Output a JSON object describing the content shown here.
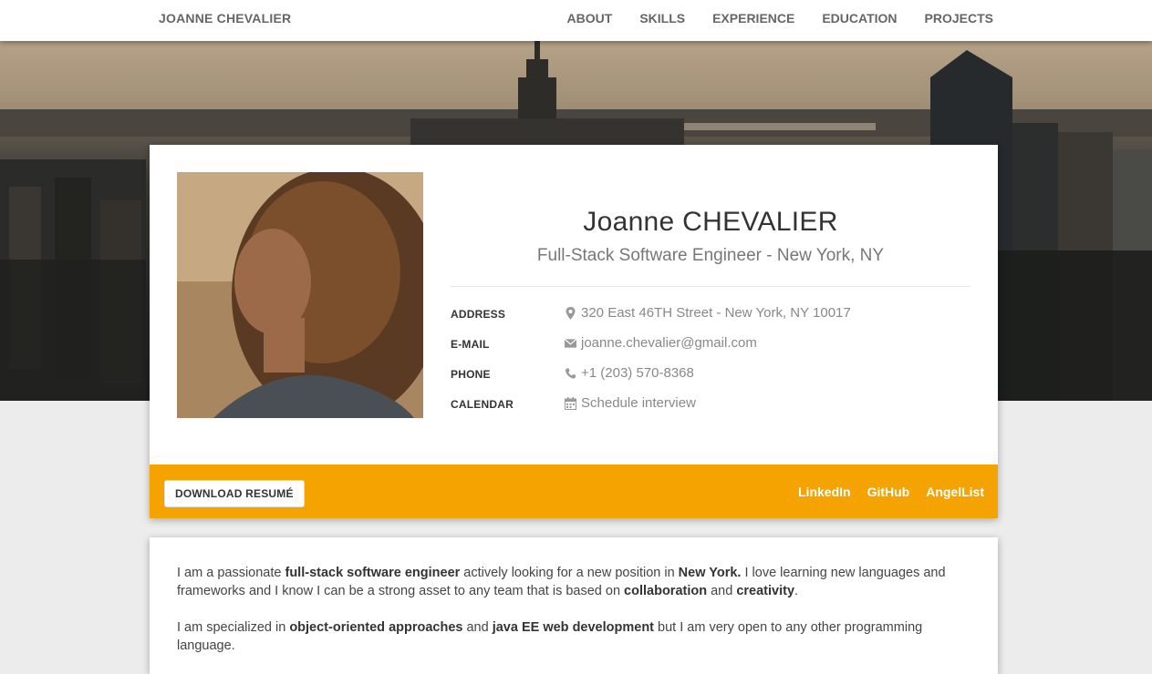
{
  "nav": {
    "brand": "JOANNE CHEVALIER",
    "links": [
      "ABOUT",
      "SKILLS",
      "EXPERIENCE",
      "EDUCATION",
      "PROJECTS"
    ]
  },
  "profile": {
    "name": "Joanne CHEVALIER",
    "title": "Full-Stack Software Engineer - New York, NY",
    "info": [
      {
        "label": "ADDRESS",
        "value": "320 East 46TH Street - New York, NY 10017",
        "icon": "map-marker-icon"
      },
      {
        "label": "E-MAIL",
        "value": "joanne.chevalier@gmail.com",
        "icon": "envelope-icon"
      },
      {
        "label": "PHONE",
        "value": "+1 (203) 570-8368",
        "icon": "phone-icon"
      },
      {
        "label": "CALENDAR",
        "value": "Schedule interview",
        "icon": "calendar-icon"
      }
    ]
  },
  "footer": {
    "download_label": "DOWNLOAD RESUMÉ",
    "social": [
      "LinkedIn",
      "GitHub",
      "AngelList"
    ]
  },
  "about": {
    "p1": {
      "t1": "I am a passionate ",
      "b1": "full-stack software engineer",
      "t2": " actively looking for a new position in ",
      "b2": "New York.",
      "t3": " I love learning new languages and frameworks and I know I can be a strong asset to any team that is based on ",
      "b3": "collaboration",
      "t4": " and ",
      "b4": "creativity",
      "t5": "."
    },
    "p2": {
      "t1": "I am specialized in ",
      "b1": "object-oriented approaches",
      "t2": " and ",
      "b2": "java EE web development",
      "t3": " but I am very open to any other programming language."
    }
  },
  "colors": {
    "accent": "#f4a300",
    "nav_text": "#666666",
    "page_bg": "#ececec"
  }
}
